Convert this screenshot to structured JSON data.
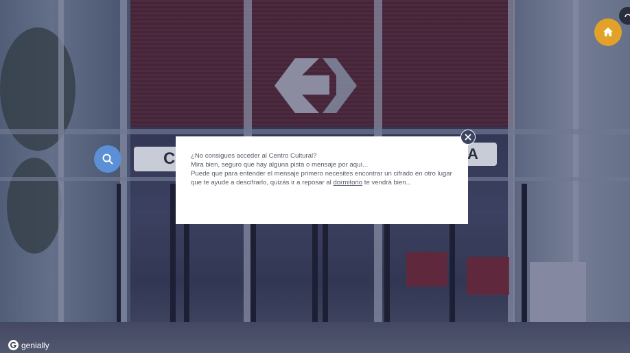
{
  "dialog": {
    "line1": "¿No consigues acceder al Centro Cultural?",
    "line2": "Mira bien, seguro que hay alguna pista o mensaje por aquí...",
    "line3_before": "Puede que para entender el mensaje primero necesites encontrar un cifrado en otro lugar que te ayude a descifrarlo, quizás ir a reposar al ",
    "line3_link": "dormitorio",
    "line3_after": " te vendrá bien..."
  },
  "scene": {
    "sign_left_letter": "C",
    "sign_right_letter": "A"
  },
  "brand": {
    "name": "genially"
  },
  "icons": {
    "search": "search-icon",
    "home": "home-icon",
    "close": "close-icon",
    "brand": "genially-logo-icon"
  },
  "colors": {
    "search_button": "#5b8fd6",
    "home_button": "#e2a22a",
    "close_button": "#3c4560",
    "dialog_bg": "#ffffff",
    "overlay": "#232850"
  }
}
